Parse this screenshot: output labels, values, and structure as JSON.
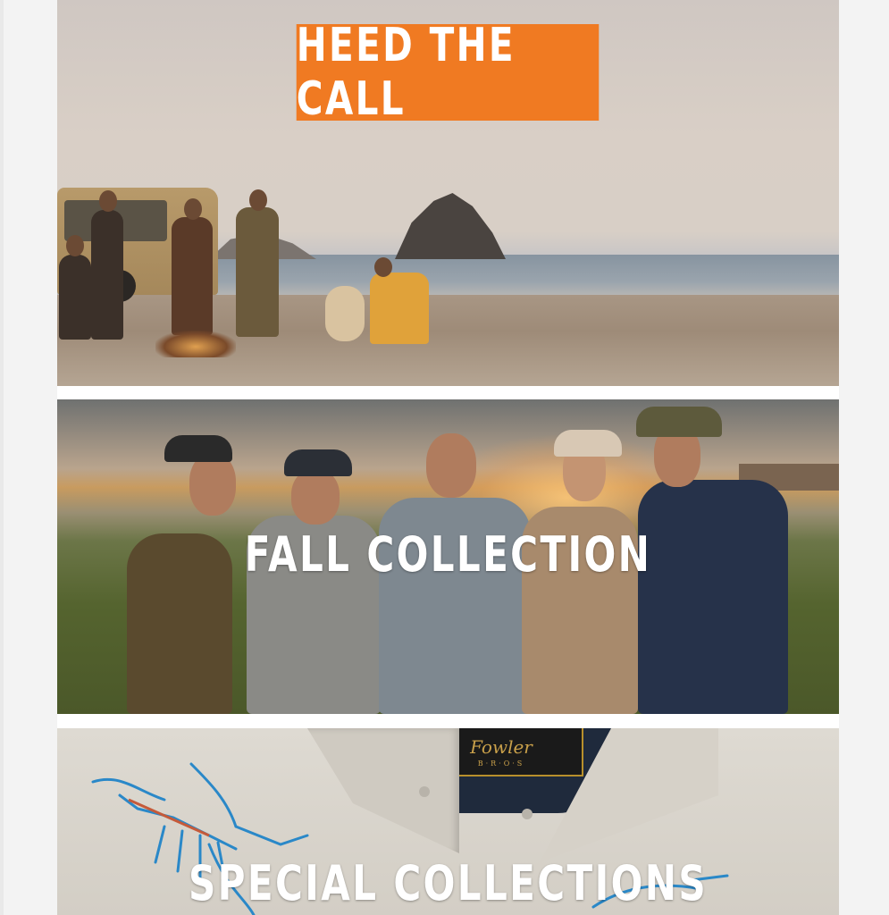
{
  "hero": {
    "cta_label": "HEED THE CALL",
    "image_icon": "beach-campfire-photo"
  },
  "fall_collection": {
    "title": "FALL COLLECTION",
    "image_icon": "friends-toasting-photo"
  },
  "special_collections": {
    "title": "SPECIAL COLLECTIONS",
    "label_text": "Fowler",
    "label_sub": "B·R·O·S",
    "image_icon": "embroidered-shirt-photo"
  },
  "colors": {
    "cta_orange": "#f07a22",
    "page_bg": "#f3f3f3",
    "content_bg": "#ffffff"
  }
}
